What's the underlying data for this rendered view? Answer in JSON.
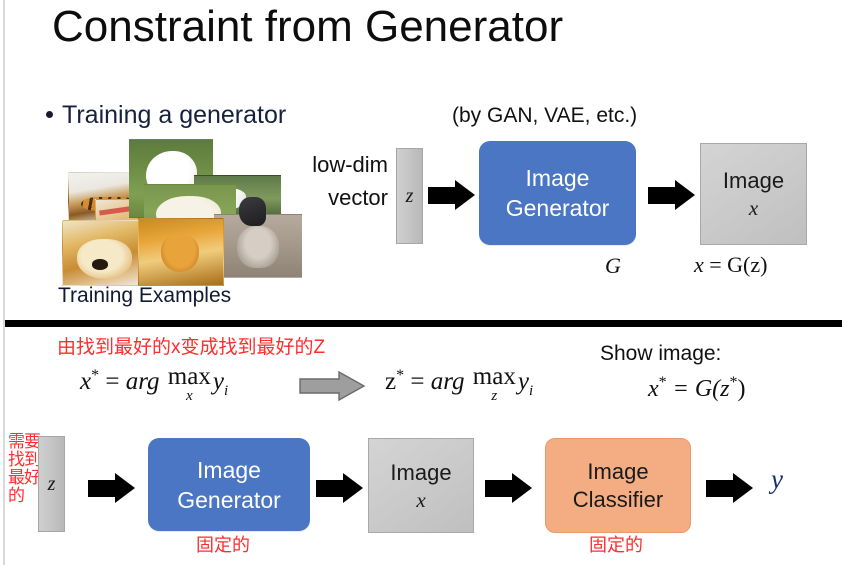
{
  "slide": {
    "title": "Constraint from Generator",
    "divider_color": "#000000",
    "background": "#ffffff"
  },
  "top_section": {
    "bullet": "Training a generator",
    "byline": "(by GAN, VAE, etc.)",
    "collage_label": "Training Examples",
    "collage_items": [
      {
        "name": "tiger-photo"
      },
      {
        "name": "samoyed-dog-photo"
      },
      {
        "name": "bird-photo"
      },
      {
        "name": "alpaca-photo"
      },
      {
        "name": "tabby-cat-photo"
      },
      {
        "name": "shiba-inu-photo"
      },
      {
        "name": "orange-cat-photo"
      },
      {
        "name": "wolf-photo"
      }
    ],
    "lowdim_line1": "low-dim",
    "lowdim_line2": "vector",
    "z_label": "z",
    "generator_line1": "Image",
    "generator_line2": "Generator",
    "generator_under": "G",
    "image_line1": "Image",
    "image_var": "x",
    "image_under_x": "x",
    "image_under_eq": " = G(z)",
    "colors": {
      "generator_blue": "#4a76c4",
      "image_gray": "#c9c9c9",
      "z_gray": "#c6c6c6"
    }
  },
  "bottom_section": {
    "note_cn": "由找到最好的x变成找到最好的Z",
    "formula_left": {
      "lhs": "x",
      "star": "*",
      "eq": " = ",
      "arg": "arg",
      "max": "max",
      "max_sub": "x",
      "rhs": "y",
      "rhs_sub": "i"
    },
    "formula_right": {
      "lhs": "z",
      "star": "*",
      "eq": " = ",
      "arg": "arg",
      "max": "max",
      "max_sub": "z",
      "rhs": "y",
      "rhs_sub": "i"
    },
    "show_image_label": "Show image:",
    "show_image_formula": {
      "lhs": "x",
      "star": "*",
      "eq": " = G(z",
      "star2": "*",
      "close": ")"
    },
    "red_vertical_col_right": "要到好",
    "red_vertical_col_left": "需找最的",
    "z_label": "z",
    "generator_line1": "Image",
    "generator_line2": "Generator",
    "generator_fixed_cn": "固定的",
    "image_line1": "Image",
    "image_var": "x",
    "classifier_line1": "Image",
    "classifier_line2": "Classifier",
    "classifier_fixed_cn": "固定的",
    "output_label": "y",
    "colors": {
      "generator_blue": "#4a76c4",
      "classifier_orange": "#f4ad83",
      "image_gray": "#c9c9c9",
      "red_text": "#ff2d2d",
      "gray_arrow": "#9e9e9e"
    }
  }
}
